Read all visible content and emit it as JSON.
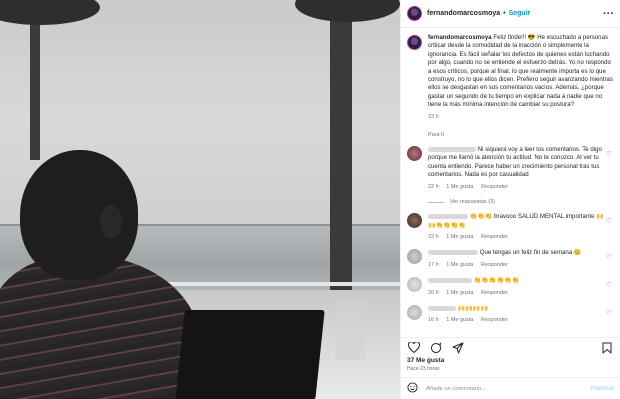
{
  "header": {
    "username": "fernandomarcosmoya",
    "separator": "•",
    "follow_label": "Seguir",
    "more_icon": "more-horizontal-icon"
  },
  "caption": {
    "username": "fernandomarcosmoya",
    "text": "Feliz finde!!! 😎 He escuchado a personas criticar desde la comodidad de la inacción o simplemente la ignorancia. Es fácil señalar los defectos de quienes están luchando por algo, cuando no se entiende el esfuerzo detrás. Yo no respondo a esos críticos, porque al final, lo que realmente importa es lo que construyo, no lo que ellos dicen. Prefiero seguir avanzando mientras ellos se desgastan en sus comentarios vacíos. Además, ¿porque gastar un segundo de tu tiempo en explicar nada a nadie que no tiene la más mínima intención de cambiar su postura?",
    "time": "23 h"
  },
  "translate_label": "Para ti",
  "comments": [
    {
      "text": "Ni siquiera voy a leer los comentarios. Te digo porque me llamó la atención tu actitud. No te conozco. Al ver tu cuenta entiendo. Parece haber un crecimiento personal tras tus comentarios. Nada es por casualidad",
      "time": "22 h",
      "likes": "1 Me gusta",
      "reply": "Responder"
    },
    {
      "emoji_prefix": "👏👏👏",
      "text": "bravooo SALUD MENTAL importante",
      "emoji_suffix": "🙌🙌👏👏👏👏",
      "time": "22 h",
      "likes": "1 Me gusta",
      "reply": "Responder"
    },
    {
      "text": "Que tengas un feliz fin de semana 😊",
      "time": "17 h",
      "likes": "1 Me gusta",
      "reply": "Responder"
    },
    {
      "emoji": "👏👏👏👏👏👏",
      "time": "20 h",
      "likes": "1 Me gusta",
      "reply": "Responder"
    },
    {
      "emoji": "🙌🙌🙌🙌",
      "time": "16 h",
      "likes": "1 Me gusta",
      "reply": "Responder"
    }
  ],
  "replies_label": "Ver respuestas (3)",
  "footer": {
    "likes": "37 Me gusta",
    "ago": "Hace 23 horas",
    "comment_placeholder": "Añade un comentario...",
    "post_label": "Publicar"
  }
}
